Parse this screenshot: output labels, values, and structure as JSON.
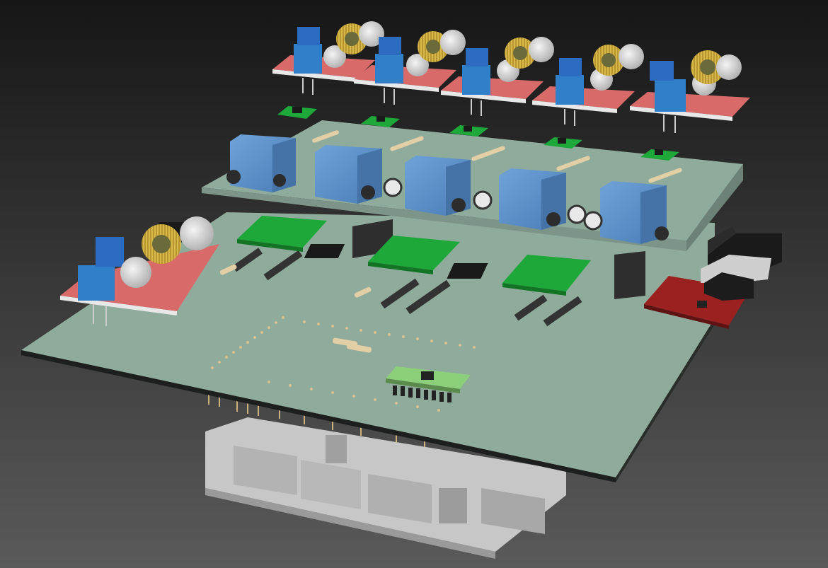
{
  "scene": {
    "background_top": "#161616",
    "background_bottom": "#5a5a5a",
    "colors": {
      "main_pcb": "#8fab9b",
      "main_pcb_edge": "#1c1f1d",
      "arduino": "#bdbdbd",
      "relay": "#5b8fc8",
      "converter_pcb": "#d96a6a",
      "terminal_block": "#2f80c8",
      "trimpot": "#2b6bc0",
      "inductor": "#d7b84a",
      "capacitor": "#d9d9d9",
      "driver_pcb": "#1ea83a",
      "ic": "#1a1a1a",
      "header": "#333333",
      "pins": "#cdb27a",
      "resistor": "#e2cfa6",
      "sensor_pcb": "#9b2020",
      "usb_connector": "#cfcfcf"
    },
    "objects": [
      {
        "name": "buck-converter-module",
        "count": 6
      },
      {
        "name": "relay",
        "count": 5
      },
      {
        "name": "stepper-driver-module",
        "count": 3
      },
      {
        "name": "small-ic-module",
        "count": 5
      },
      {
        "name": "red-breakout-board",
        "count": 1
      },
      {
        "name": "accelerometer-module",
        "count": 1
      },
      {
        "name": "arduino-mega-board",
        "count": 1
      },
      {
        "name": "usb-connector",
        "count": 2
      }
    ]
  }
}
